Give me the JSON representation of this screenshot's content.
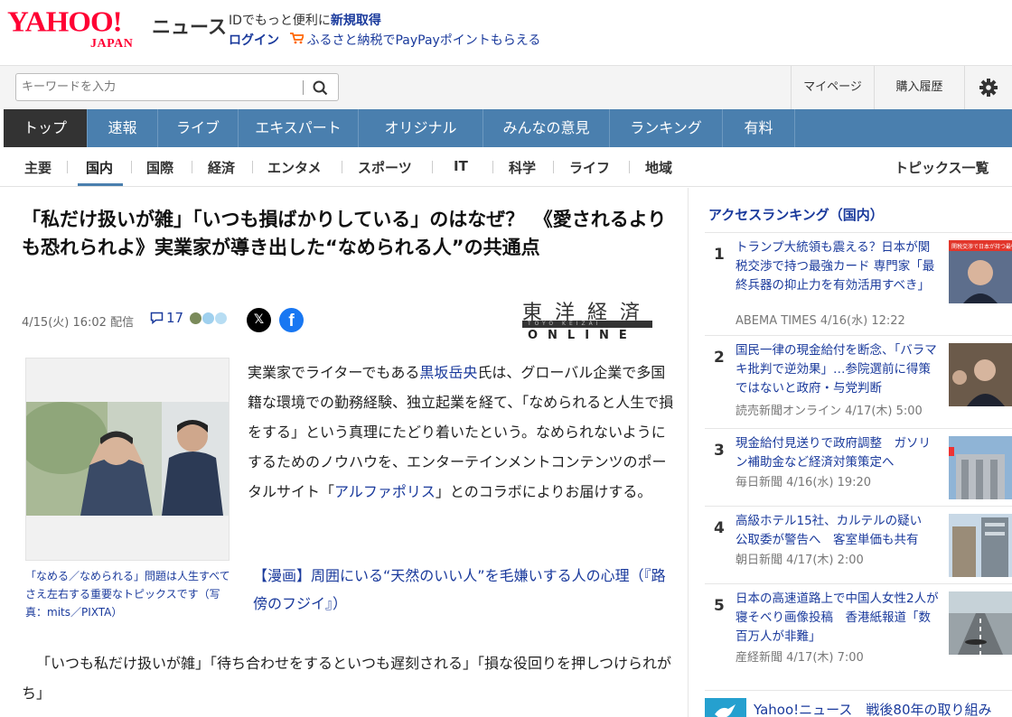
{
  "header": {
    "logo_main": "YAHOO!",
    "logo_sub": "JAPAN",
    "service_name": "ニュース",
    "promo_text": "IDでもっと便利に",
    "promo_link": "新規取得",
    "login_label": "ログイン",
    "furusato_text": "ふるさと納税でPayPayポイントもらえる"
  },
  "search": {
    "placeholder": "キーワードを入力"
  },
  "utility": {
    "mypage": "マイページ",
    "history": "購入履歴",
    "settings_icon": "gear-icon"
  },
  "main_nav": [
    {
      "label": "トップ",
      "active": true
    },
    {
      "label": "速報"
    },
    {
      "label": "ライブ"
    },
    {
      "label": "エキスパート"
    },
    {
      "label": "オリジナル"
    },
    {
      "label": "みんなの意見"
    },
    {
      "label": "ランキング"
    },
    {
      "label": "有料"
    }
  ],
  "sub_nav": [
    {
      "label": "主要"
    },
    {
      "label": "国内",
      "active": true
    },
    {
      "label": "国際"
    },
    {
      "label": "経済"
    },
    {
      "label": "エンタメ"
    },
    {
      "label": "スポーツ"
    },
    {
      "label": "IT"
    },
    {
      "label": "科学"
    },
    {
      "label": "ライフ"
    },
    {
      "label": "地域"
    }
  ],
  "topics_link": "トピックス一覧",
  "article": {
    "headline": "「私だけ扱いが雑」「いつも損ばかりしている」のはなぜ？　《愛されるよりも恐れられよ》実業家が導き出した“なめられる人”の共通点",
    "date": "4/15(火) 16:02 配信",
    "comment_count": "17",
    "publisher_kanji": "東洋経済",
    "publisher_small": "TOYO KEIZAI",
    "publisher_online": "ONLINE",
    "body_before_link": "実業家でライターでもある",
    "body_author": "黒坂岳央",
    "body_middle": "氏は、グローバル企業で多国籍な環境での勤務経験、独立起業を経て、「なめられると人生で損をする」という真理にたどり着いたという。なめられないようにするためのノウハウを、エンターテインメントコンテンツのポータルサイト「",
    "body_site": "アルファポリス",
    "body_after": "」とのコラボによりお届けする。",
    "related_link": "【漫画】周囲にいる“天然のいい人”を毛嫌いする人の心理（『路傍のフジイ』）",
    "caption": "「なめる／なめられる」問題は人生すべてさえ左右する重要なトピックスです（写真：mits／PIXTA）",
    "quote": "「いつも私だけ扱いが雑」「待ち合わせをするといつも遅刻される」「損な役回りを押しつけられがち」"
  },
  "ranking": {
    "title": "アクセスランキング（国内）",
    "items": [
      {
        "rank": "1",
        "title": "トランプ大統領も震える？日本が関税交渉で持つ最強カード 専門家「最終兵器の抑止力を有効活用すべき」",
        "source": "ABEMA TIMES 4/16(水) 12:22"
      },
      {
        "rank": "2",
        "title": "国民一律の現金給付を断念、「バラマキ批判で逆効果」…参院選前に得策ではないと政府・与党判断",
        "source": "読売新聞オンライン 4/17(木) 5:00"
      },
      {
        "rank": "3",
        "title": "現金給付見送りで政府調整　ガソリン補助金など経済対策策定へ",
        "source": "毎日新聞 4/16(水) 19:20"
      },
      {
        "rank": "4",
        "title": "高級ホテル15社、カルテルの疑い　公取委が警告へ　客室単価も共有",
        "source": "朝日新聞 4/17(木) 2:00"
      },
      {
        "rank": "5",
        "title": "日本の高速道路上で中国人女性2人が寝そべり画像投稿　香港紙報道「数百万人が非難」",
        "source": "産経新聞 4/17(木) 7:00"
      }
    ],
    "thumb1_caption": "関税交渉で日本が持つ最強カード"
  },
  "banner": {
    "text": "Yahoo!ニュース　戦後80年の取り組み"
  },
  "colors": {
    "nav_bg": "#4a7fae",
    "nav_active": "#333333",
    "link": "#1a3a9c",
    "brand_red": "#ff0033"
  }
}
